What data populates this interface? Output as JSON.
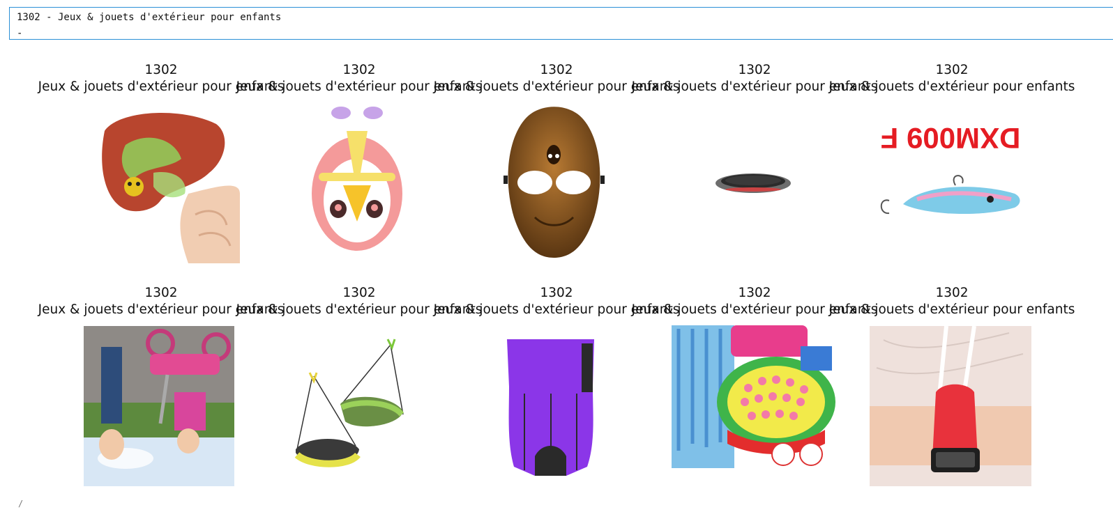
{
  "stdout": {
    "line1": "1302 - Jeux & jouets d'extérieur pour enfants",
    "line2": "-"
  },
  "panels": [
    {
      "code": "1302",
      "label": "Jeux & jouets d'extérieur pour enfants",
      "image": "red-green-slime-toy-image"
    },
    {
      "code": "1302",
      "label": "Jeux & jouets d'extérieur pour enfants",
      "image": "pink-penguin-squishy-image"
    },
    {
      "code": "1302",
      "label": "Jeux & jouets d'extérieur pour enfants",
      "image": "bronze-skull-mask-image"
    },
    {
      "code": "1302",
      "label": "Jeux & jouets d'extérieur pour enfants",
      "image": "small-round-trampoline-image"
    },
    {
      "code": "1302",
      "label": "Jeux & jouets d'extérieur pour enfants",
      "image": "fishing-lure-image"
    },
    {
      "code": "1302",
      "label": "Jeux & jouets d'extérieur pour enfants",
      "image": "child-tricycle-image"
    },
    {
      "code": "1302",
      "label": "Jeux & jouets d'extérieur pour enfants",
      "image": "toy-parachutes-image"
    },
    {
      "code": "1302",
      "label": "Jeux & jouets d'extérieur pour enfants",
      "image": "purple-waist-trainer-image"
    },
    {
      "code": "1302",
      "label": "Jeux & jouets d'extérieur pour enfants",
      "image": "fishing-game-toy-image"
    },
    {
      "code": "1302",
      "label": "Jeux & jouets d'extérieur pour enfants",
      "image": "red-watch-band-image"
    }
  ],
  "bottom_marker": "/",
  "sticker_text": "DXM009 F"
}
